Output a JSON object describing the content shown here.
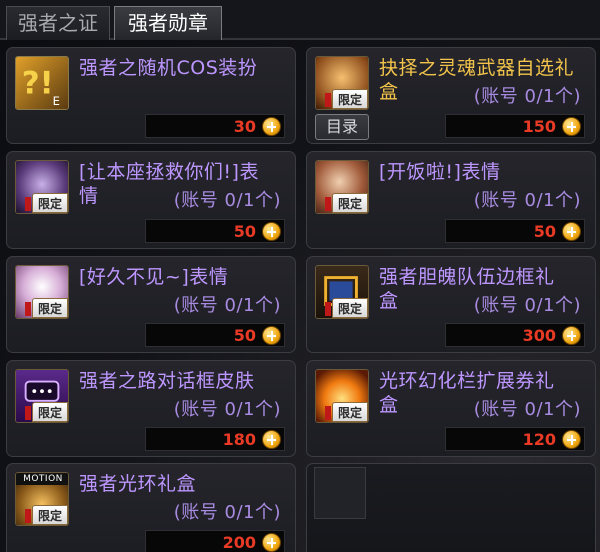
{
  "tabs": [
    {
      "label": "强者之证",
      "active": false
    },
    {
      "label": "强者勋章",
      "active": true
    }
  ],
  "badge_text": "限定",
  "currency_icon": "cera-coin-icon",
  "items": [
    {
      "title_line1": "强者之随机COS装扮",
      "title_line2": "",
      "limit": "",
      "price": "30",
      "title_color": "#bd96ff"
    },
    {
      "title_line1": "抉择之灵魂武器自选礼",
      "title_line2": "盒",
      "limit": "(账号 0/1个)",
      "price": "150",
      "title_color": "#f3c44b",
      "catalog_label": "目录"
    },
    {
      "title_line1": "[让本座拯救你们!]表",
      "title_line2": "情",
      "limit": "(账号 0/1个)",
      "price": "50",
      "title_color": "#bd96ff"
    },
    {
      "title_line1": "[开饭啦!]表情",
      "title_line2": "",
      "limit": "(账号 0/1个)",
      "price": "50",
      "title_color": "#bd96ff"
    },
    {
      "title_line1": "[好久不见~]表情",
      "title_line2": "",
      "limit": "(账号 0/1个)",
      "price": "50",
      "title_color": "#bd96ff"
    },
    {
      "title_line1": "强者胆魄队伍边框礼",
      "title_line2": "盒",
      "limit": "(账号 0/1个)",
      "price": "300",
      "title_color": "#bd96ff"
    },
    {
      "title_line1": "强者之路对话框皮肤",
      "title_line2": "",
      "limit": "(账号 0/1个)",
      "price": "180",
      "title_color": "#bd96ff"
    },
    {
      "title_line1": "光环幻化栏扩展券礼",
      "title_line2": "盒",
      "limit": "(账号 0/1个)",
      "price": "120",
      "title_color": "#bd96ff"
    },
    {
      "title_line1": "强者光环礼盒",
      "title_line2": "",
      "limit": "(账号 0/1个)",
      "price": "200",
      "title_color": "#bd96ff",
      "icon_caption": "MOTION"
    }
  ]
}
